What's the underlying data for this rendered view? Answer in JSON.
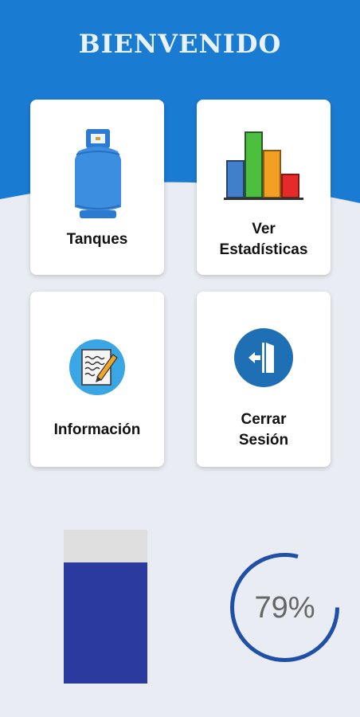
{
  "header": {
    "title": "BIENVENIDO"
  },
  "menu": {
    "tanques": {
      "label": "Tanques",
      "icon": "gas-cylinder-icon"
    },
    "estadisticas": {
      "line1": "Ver",
      "line2": "Estadísticas",
      "icon": "bar-chart-icon"
    },
    "informacion": {
      "label": "Información",
      "icon": "notepad-icon"
    },
    "cerrar": {
      "line1": "Cerrar",
      "line2": "Sesión",
      "icon": "exit-door-icon"
    }
  },
  "indicators": {
    "tank_level_fraction": 0.79,
    "percent_value": 79,
    "percent_text": "79%"
  },
  "colors": {
    "header_blue": "#1a7bd3",
    "background": "#e9edf3",
    "level_fill": "#2a3a9e",
    "gauge": "#1f4fa6"
  }
}
